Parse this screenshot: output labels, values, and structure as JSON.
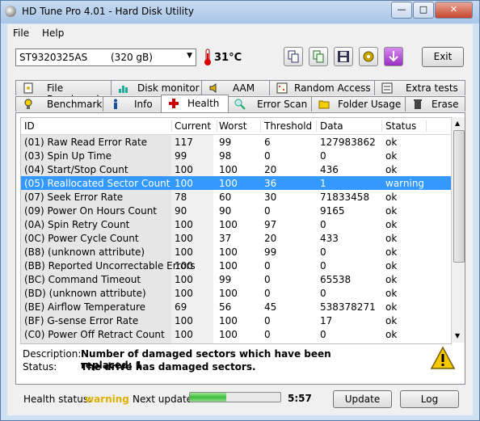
{
  "window": {
    "title": "HD Tune Pro 4.01 - Hard Disk Utility",
    "minimize": "—",
    "maximize": "□",
    "close": "✕"
  },
  "menu": [
    "File",
    "Help"
  ],
  "drive": {
    "model": "ST9320325AS",
    "capacity": "(320 gB)"
  },
  "temperature": "31°C",
  "toolbar": {
    "exit_label": "Exit"
  },
  "tabs_row1": [
    "File Benchmark",
    "Disk monitor",
    "AAM",
    "Random Access",
    "Extra tests"
  ],
  "tabs_row2": [
    "Benchmark",
    "Info",
    "Health",
    "Error Scan",
    "Folder Usage",
    "Erase"
  ],
  "active_tab": "Health",
  "table": {
    "columns": [
      "ID",
      "Current",
      "Worst",
      "Threshold",
      "Data",
      "Status"
    ],
    "rows": [
      [
        "(01) Raw Read Error Rate",
        "117",
        "99",
        "6",
        "127983862",
        "ok"
      ],
      [
        "(03) Spin Up Time",
        "99",
        "98",
        "0",
        "0",
        "ok"
      ],
      [
        "(04) Start/Stop Count",
        "100",
        "100",
        "20",
        "436",
        "ok"
      ],
      [
        "(05) Reallocated Sector Count",
        "100",
        "100",
        "36",
        "1",
        "warning"
      ],
      [
        "(07) Seek Error Rate",
        "78",
        "60",
        "30",
        "71833458",
        "ok"
      ],
      [
        "(09) Power On Hours Count",
        "90",
        "90",
        "0",
        "9165",
        "ok"
      ],
      [
        "(0A) Spin Retry Count",
        "100",
        "100",
        "97",
        "0",
        "ok"
      ],
      [
        "(0C) Power Cycle Count",
        "100",
        "37",
        "20",
        "433",
        "ok"
      ],
      [
        "(B8) (unknown attribute)",
        "100",
        "100",
        "99",
        "0",
        "ok"
      ],
      [
        "(BB) Reported Uncorrectable Errors",
        "100",
        "100",
        "0",
        "0",
        "ok"
      ],
      [
        "(BC) Command Timeout",
        "100",
        "99",
        "0",
        "65538",
        "ok"
      ],
      [
        "(BD) (unknown attribute)",
        "100",
        "100",
        "0",
        "0",
        "ok"
      ],
      [
        "(BE) Airflow Temperature",
        "69",
        "56",
        "45",
        "538378271",
        "ok"
      ],
      [
        "(BF) G-sense Error Rate",
        "100",
        "100",
        "0",
        "17",
        "ok"
      ],
      [
        "(C0) Power Off Retract Count",
        "100",
        "100",
        "0",
        "0",
        "ok"
      ]
    ],
    "selected_row": 3
  },
  "details": {
    "description_label": "Description:",
    "description_value": "Number of damaged sectors which have been replaced: 1",
    "status_label": "Status:",
    "status_value": "The drive has damaged sectors."
  },
  "footer": {
    "health_label": "Health status:",
    "health_value": "warning",
    "next_update_label": "Next update:",
    "progress": 0.4,
    "countdown": "5:57",
    "update_label": "Update",
    "log_label": "Log"
  },
  "colors": {
    "warning_text": "#e0b000",
    "selection": "#3399ff",
    "accent_red": "#cc0000"
  }
}
